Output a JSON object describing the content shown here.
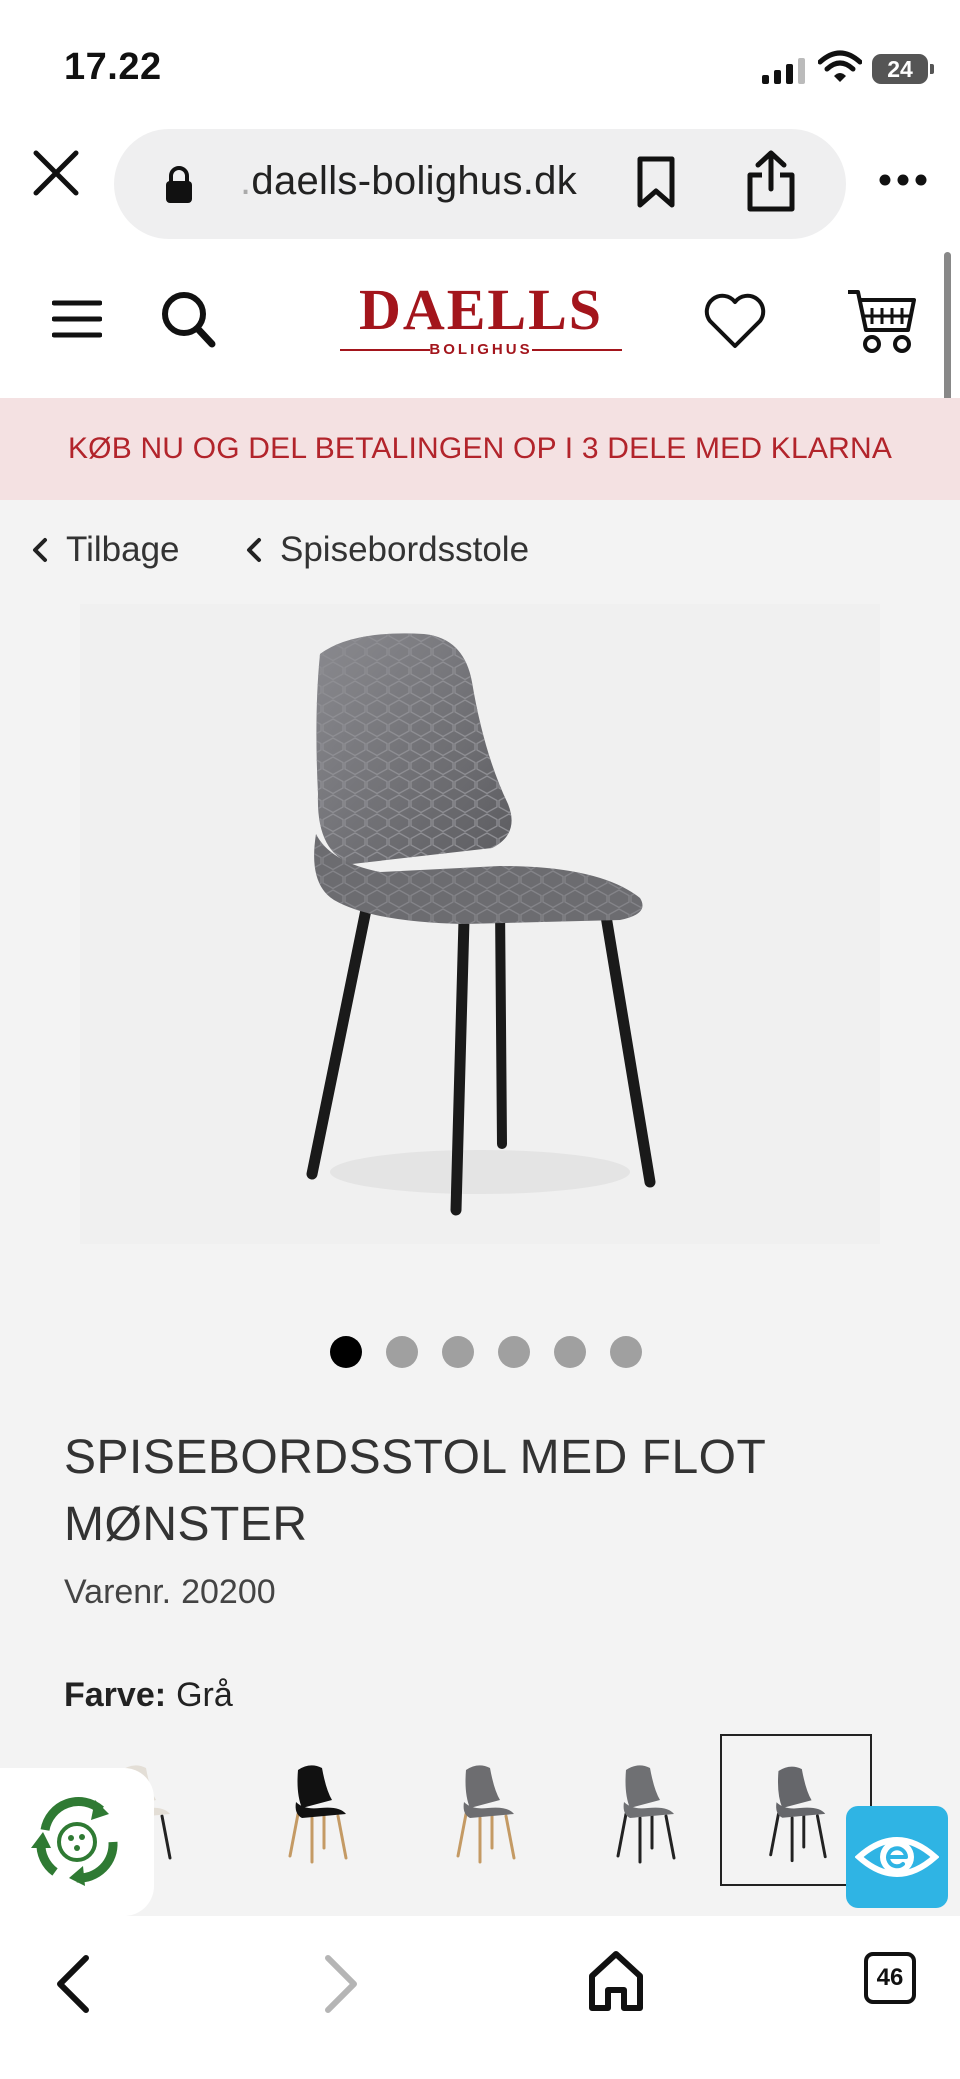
{
  "status_bar": {
    "time": "17.22",
    "battery": "24",
    "icons": [
      "signal-icon",
      "wifi-icon",
      "battery-icon"
    ]
  },
  "browser": {
    "url_dim_prefix": ".",
    "url_domain": "daells-bolighus.dk",
    "icons": [
      "close-icon",
      "lock-icon",
      "bookmark-icon",
      "share-icon",
      "more-icon"
    ]
  },
  "header": {
    "logo_main": "DAELLS",
    "logo_sub": "BOLIGHUS",
    "brand_color": "#a3151c",
    "icons": [
      "menu-icon",
      "search-icon",
      "heart-icon",
      "cart-icon"
    ]
  },
  "banner": {
    "text": "KØB NU OG DEL BETALINGEN OP I 3 DELE MED KLARNA",
    "bg_color": "#f4e1e2",
    "text_color": "#b2242b"
  },
  "breadcrumbs": {
    "back": "Tilbage",
    "category": "Spisebordsstole"
  },
  "gallery": {
    "dots": [
      true,
      false,
      false,
      false,
      false,
      false
    ]
  },
  "product": {
    "title": "SPISEBORDSSTOL MED FLOT MØNSTER",
    "sku_label": "Varenr.",
    "sku": "20200",
    "color_label": "Farve:",
    "color_value": "Grå"
  },
  "swatches": [
    {
      "name": "swatch-beige",
      "seat": "#e3ded6",
      "legs": "#222"
    },
    {
      "name": "swatch-black-wood",
      "seat": "#111",
      "legs": "#c49a64"
    },
    {
      "name": "swatch-grey-wood",
      "seat": "#6d6d70",
      "legs": "#c49a64"
    },
    {
      "name": "swatch-grey-black",
      "seat": "#6f7073",
      "legs": "#222"
    },
    {
      "name": "swatch-grey-velvet",
      "seat": "#65666a",
      "legs": "#222",
      "selected": true
    }
  ],
  "toolbar": {
    "tabs_count": "46",
    "icons": [
      "back-arrow-icon",
      "forward-arrow-icon",
      "home-icon",
      "tabs-icon"
    ]
  }
}
